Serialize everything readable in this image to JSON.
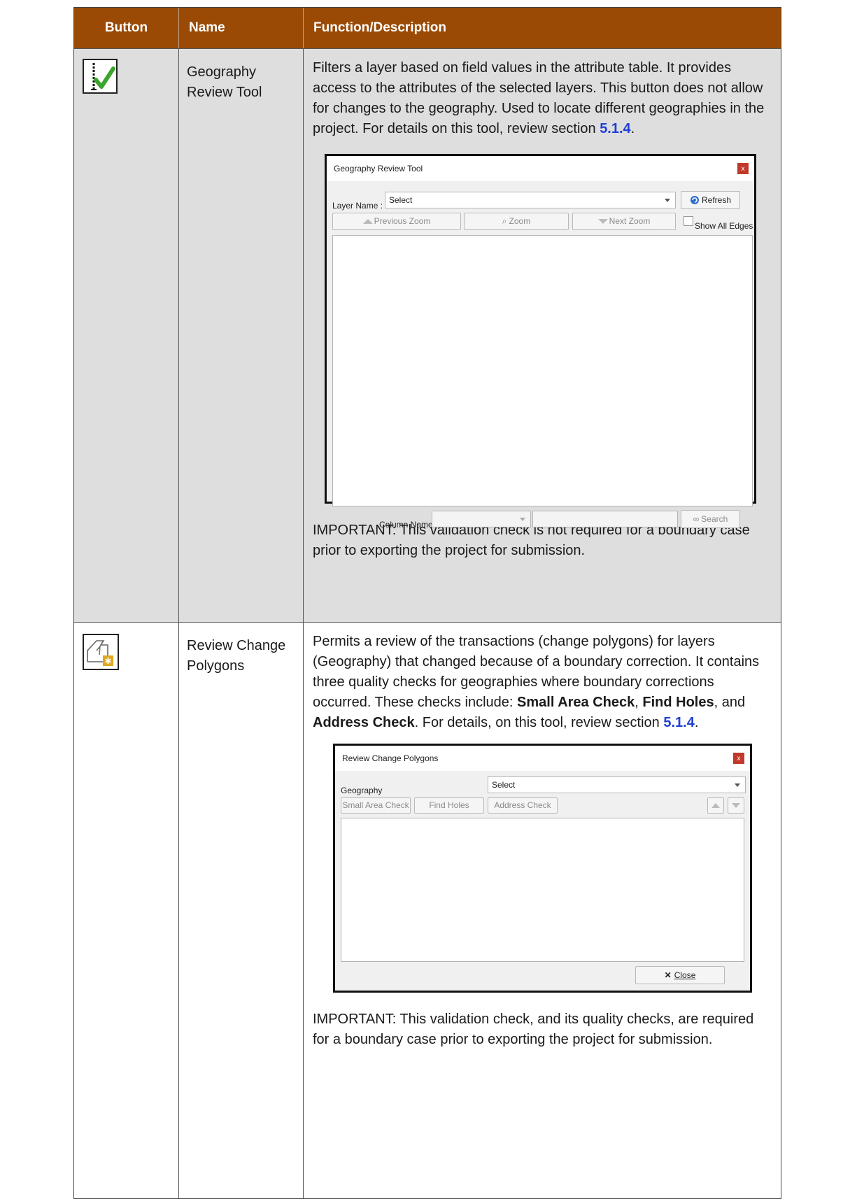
{
  "header": {
    "button": "Button",
    "name": "Name",
    "function": "Function/Description"
  },
  "rows": [
    {
      "name": "Geography Review Tool",
      "icon": "checkmark-icon",
      "desc_text": "Filters a layer based on field values in the attribute table. It provides access to the attributes of the selected layers. This button does not allow for changes to the geography. Used to locate different geographies in the project. For details on this tool, review section ",
      "section_link": "5.1.4",
      "period": ".",
      "important": "IMPORTANT: This validation check is not required for a boundary case prior to exporting the project for submission.",
      "dialog": {
        "title": "Geography Review Tool",
        "close_x": "x",
        "layer_name_label": "Layer Name :",
        "layer_select_value": "Select",
        "refresh_label": "Refresh",
        "previous_zoom_label": "Previous Zoom",
        "zoom_label": "Zoom",
        "next_zoom_label": "Next Zoom",
        "show_all_edges_label": "Show All Edges",
        "column_name_label": "Column Name :",
        "search_label": "Search"
      }
    },
    {
      "name": "Review Change Polygons",
      "icon": "polygon-change-icon",
      "desc_a": "Permits a review of the transactions (change polygons) for layers (Geography) that changed because of a boundary correction. It contains three quality checks for geographies where boundary corrections occurred. These checks include: ",
      "bold1": "Small Area Check",
      "sep1": ", ",
      "bold2": "Find Holes",
      "sep2": ", and ",
      "bold3": "Address Check",
      "desc_b": ". For details, on this tool, review section ",
      "section_link": "5.1.4",
      "period": ".",
      "important": "IMPORTANT: This validation check, and its quality checks, are required for a boundary case prior to exporting the project for submission.",
      "dialog": {
        "title": "Review Change Polygons",
        "close_x": "x",
        "geography_label": "Geography",
        "geography_select_value": "Select",
        "small_area_check_label": "Small Area Check",
        "find_holes_label": "Find Holes",
        "address_check_label": "Address Check",
        "close_label": "Close"
      }
    }
  ]
}
